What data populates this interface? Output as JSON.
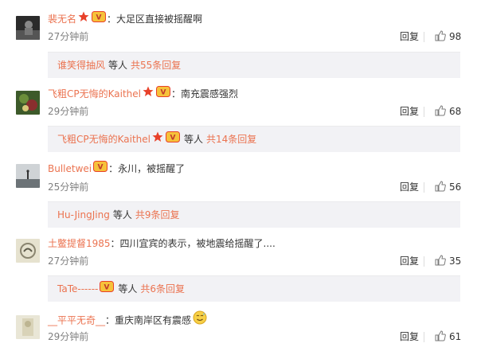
{
  "comments": [
    {
      "user": "裴无名",
      "text": "：大足区直接被摇醒啊",
      "time": "27分钟前",
      "reply_label": "回复",
      "likes": "98",
      "badges": [
        "star",
        "vip"
      ],
      "sub": {
        "user": "谁笑得抽风",
        "etc": "等人",
        "count_label": "共55条回复",
        "badges": []
      }
    },
    {
      "user": "飞粗CP无悔的Kaithel",
      "text": "：南充震感强烈",
      "time": "29分钟前",
      "reply_label": "回复",
      "likes": "68",
      "badges": [
        "star",
        "vip"
      ],
      "sub": {
        "user": "飞粗CP无悔的Kaithel",
        "etc": "等人",
        "count_label": "共14条回复",
        "badges": [
          "star",
          "vip"
        ]
      }
    },
    {
      "user": "Bulletwei",
      "text": "：永川，被摇醒了",
      "time": "25分钟前",
      "reply_label": "回复",
      "likes": "56",
      "badges": [
        "vip"
      ],
      "sub": {
        "user": "Hu-JingJing",
        "etc": "等人",
        "count_label": "共9条回复",
        "badges": []
      }
    },
    {
      "user": "土鳖提督1985",
      "text": "：四川宜宾的表示，被地震给摇醒了....",
      "time": "27分钟前",
      "reply_label": "回复",
      "likes": "35",
      "badges": [],
      "sub": {
        "user": "TaTe------",
        "etc": "等人",
        "count_label": "共6条回复",
        "badges": [
          "vip"
        ]
      }
    },
    {
      "user": "__平平无奇__",
      "text": "：重庆南岸区有震感",
      "time": "29分钟前",
      "reply_label": "回复",
      "likes": "61",
      "badges": [],
      "emoji": "sweat-smile-emoji"
    }
  ],
  "colors": {
    "username": "#eb7350",
    "time": "#808080",
    "sub_bg": "#f2f2f5",
    "star": "#e8412a",
    "vip_bg": "#f6c23a"
  },
  "icons": {
    "like": "thumbs-up-icon",
    "star": "star-badge-icon",
    "vip": "vip-badge-icon"
  }
}
